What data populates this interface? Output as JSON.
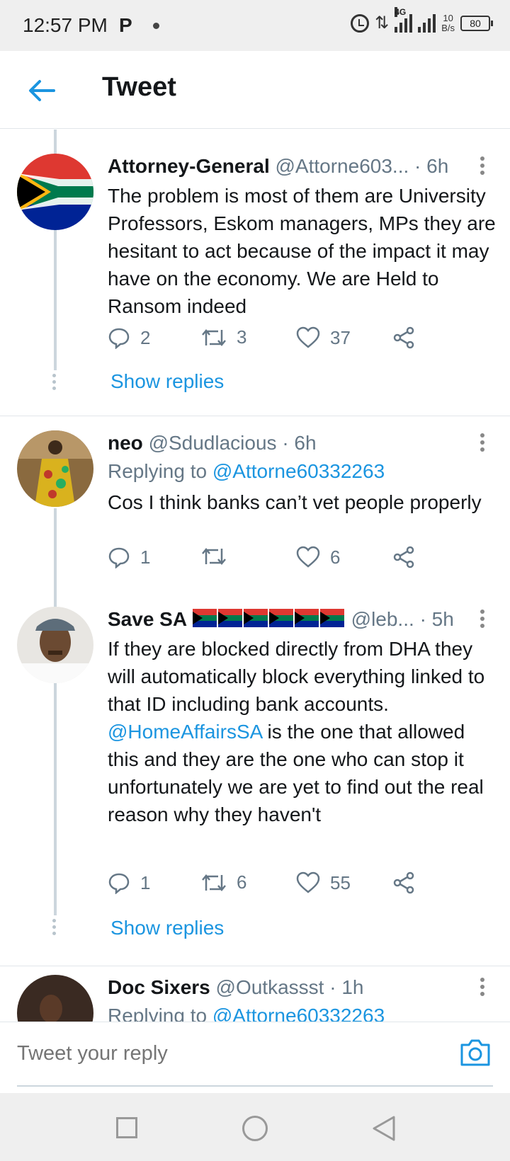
{
  "status_bar": {
    "time": "12:57 PM",
    "carrier_icon": "P",
    "network": "4G",
    "speed_value": "10",
    "speed_unit": "B/s",
    "battery": "80"
  },
  "header": {
    "title": "Tweet"
  },
  "tweets": [
    {
      "name": "Attorney-General",
      "handle": "@Attorne603...",
      "time": "· 6h",
      "replying_prefix": "",
      "replying_to": "",
      "body": "The problem is most of them are University Professors, Eskom managers, MPs they are hesitant to act because of the impact it may have on the economy. We are Held to Ransom indeed",
      "replies": "2",
      "retweets": "3",
      "likes": "37",
      "show_replies": "Show replies"
    },
    {
      "name": "neo",
      "handle": "@Sdudlacious",
      "time": "· 6h",
      "replying_prefix": "Replying to ",
      "replying_to": "@Attorne60332263",
      "body": "Cos I think banks can’t vet people properly",
      "replies": "1",
      "retweets": "",
      "likes": "6",
      "show_replies": ""
    },
    {
      "name": "Save SA",
      "handle": "@leb...",
      "time": "· 5h",
      "replying_prefix": "",
      "replying_to": "",
      "body_before": "If they are blocked directly from DHA they will automatically block everything linked to that ID including bank accounts. ",
      "body_mention": "@HomeAffairsSA",
      "body_after": " is the one that allowed this and they are the one who can stop it unfortunately we are yet to find out the real reason why they haven't",
      "replies": "1",
      "retweets": "6",
      "likes": "55",
      "show_replies": "Show replies"
    },
    {
      "name": "Doc Sixers",
      "handle": "@Outkassst",
      "time": "· 1h",
      "replying_prefix": "Replying to ",
      "replying_to": "@Attorne60332263"
    }
  ],
  "reply_bar": {
    "placeholder": "Tweet your reply"
  },
  "colors": {
    "accent": "#1b95e0",
    "secondary_text": "#657786",
    "primary_text": "#14171a"
  }
}
